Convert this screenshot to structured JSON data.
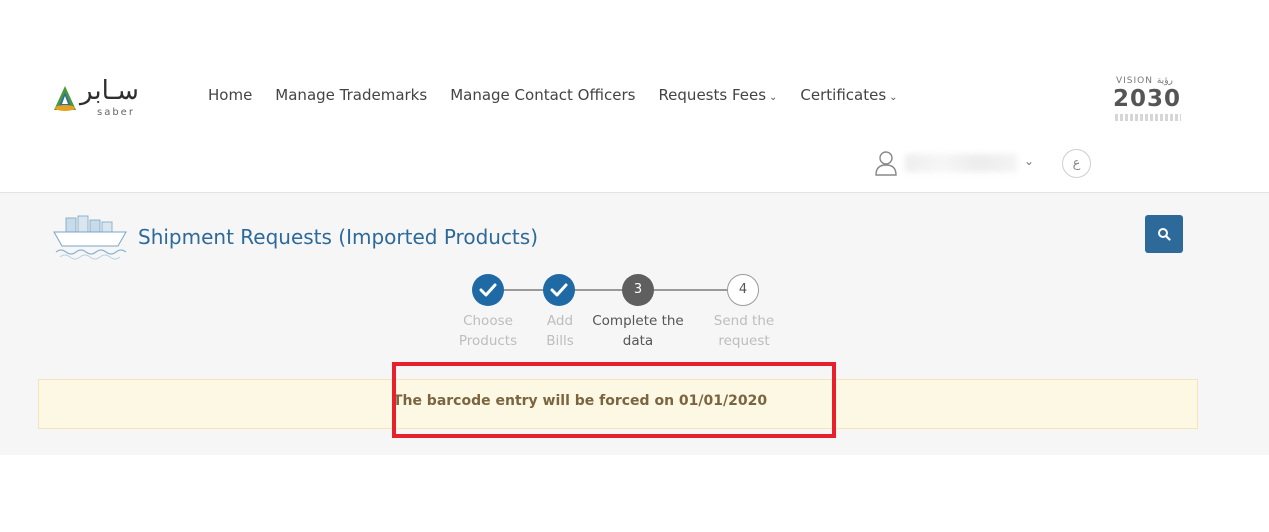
{
  "logo": {
    "arabic": "سـابر",
    "latin": "saber"
  },
  "nav": {
    "items": [
      {
        "label": "Home",
        "has_dropdown": false
      },
      {
        "label": "Manage Trademarks",
        "has_dropdown": false
      },
      {
        "label": "Manage Contact Officers",
        "has_dropdown": false
      },
      {
        "label": "Requests Fees",
        "has_dropdown": true
      },
      {
        "label": "Certificates",
        "has_dropdown": true
      }
    ]
  },
  "vision": {
    "top": "VISION رؤية",
    "year": "2030"
  },
  "user": {
    "language_button": "ع"
  },
  "page": {
    "title": "Shipment Requests (Imported Products)"
  },
  "steps": [
    {
      "number": "1",
      "line1": "Choose",
      "line2": "Products",
      "state": "done"
    },
    {
      "number": "2",
      "line1": "Add",
      "line2": "Bills",
      "state": "done"
    },
    {
      "number": "3",
      "line1": "Complete the",
      "line2": "data",
      "state": "active"
    },
    {
      "number": "4",
      "line1": "Send the",
      "line2": "request",
      "state": "future"
    }
  ],
  "alert": {
    "message": "The barcode entry will be forced on 01/01/2020"
  },
  "colors": {
    "primary": "#2d6a99",
    "step_done": "#1f6aa5",
    "step_active": "#5f5f5f",
    "alert_bg": "#fcf8e3",
    "highlight": "#e6212b"
  }
}
